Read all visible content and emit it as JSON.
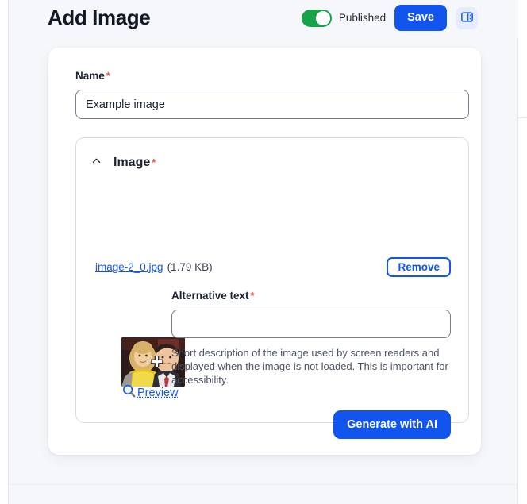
{
  "header": {
    "title": "Add Image",
    "published_toggle": {
      "label": "Published",
      "state": "on",
      "color": "#16a34a"
    },
    "save_label": "Save",
    "sidebar_toggle_icon": "panel-right-icon"
  },
  "form": {
    "name_field": {
      "label": "Name",
      "required_marker": "*",
      "value": "Example image",
      "placeholder": ""
    },
    "image_panel": {
      "title": "Image",
      "required_marker": "*",
      "collapse_icon": "chevron-up-icon",
      "expanded": true,
      "file": {
        "name": "image-2_0.jpg",
        "size": "(1.79 KB)",
        "remove_label": "Remove",
        "preview_label": "Preview",
        "preview_icon": "magnifier-icon",
        "thumbnail_alt": "photo of two people"
      },
      "alt_text_field": {
        "label": "Alternative text",
        "required_marker": "*",
        "value": "",
        "placeholder": "",
        "help": "Short description of the image used by screen readers and displayed when the image is not loaded. This is important for accessibility."
      },
      "generate_button_label": "Generate with AI"
    }
  },
  "colors": {
    "accent": "#1155ee",
    "required": "#e0564f",
    "toggle_on": "#16a34a",
    "page_background": "#f6f7fb"
  }
}
